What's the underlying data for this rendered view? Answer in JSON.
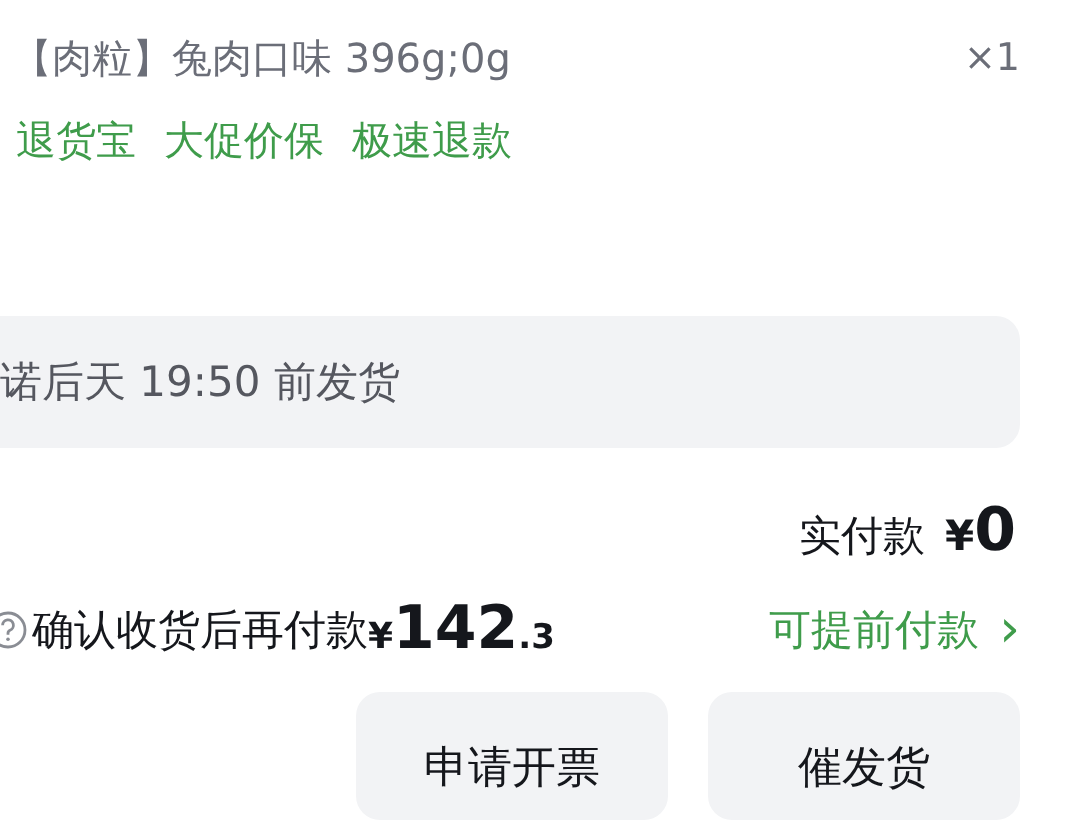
{
  "product": {
    "spec": "【肉粒】兔肉口味 396g;0g",
    "quantity": "×1"
  },
  "service_tags": [
    "退货宝",
    "大促价保",
    "极速退款"
  ],
  "shipping_notice": "诺后天 19:50 前发货",
  "paid": {
    "label": "实付款",
    "currency": "¥",
    "amount": "0"
  },
  "pay_later": {
    "label": "确认收货后再付款",
    "currency": "¥",
    "integer": "142",
    "decimal": ".3",
    "link": "可提前付款",
    "link_arrow": "›"
  },
  "buttons": [
    "申请开票",
    "催发货"
  ]
}
